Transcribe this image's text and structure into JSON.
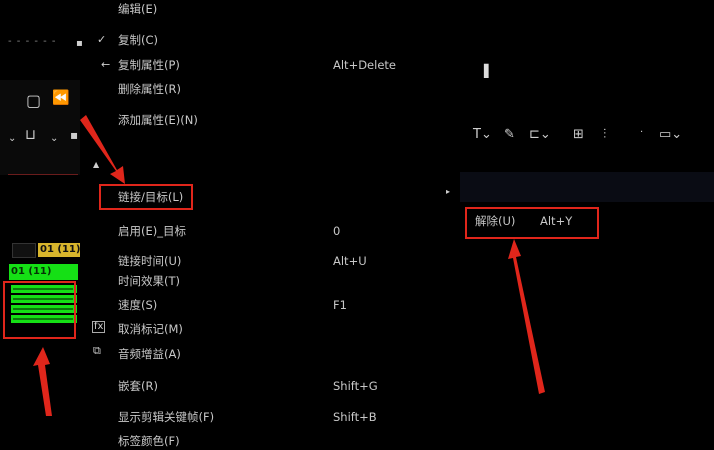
{
  "menu": {
    "items": [
      {
        "label": "编辑(E)",
        "shortcut": ""
      },
      {
        "label": "复制(C)",
        "shortcut": ""
      },
      {
        "label": "复制属性(P)",
        "shortcut": "Alt+Delete"
      },
      {
        "label": "删除属性(R)",
        "shortcut": ""
      },
      {
        "label": "添加属性(E)(N)",
        "shortcut": ""
      },
      {
        "label": "链接/目标(L)",
        "shortcut": ""
      },
      {
        "label": "启用(E)_目标",
        "shortcut": "0"
      },
      {
        "label": "链接时间(U)",
        "shortcut": "Alt+U"
      },
      {
        "label": "时间效果(T)",
        "shortcut": ""
      },
      {
        "label": "速度(S)",
        "shortcut": "F1"
      },
      {
        "label": "取消标记(M)",
        "shortcut": ""
      },
      {
        "label": "音频增益(A)",
        "shortcut": ""
      },
      {
        "label": "嵌套(R)",
        "shortcut": "Shift+G"
      },
      {
        "label": "显示剪辑关键帧(F)",
        "shortcut": "Shift+B"
      },
      {
        "label": "标签颜色(F)",
        "shortcut": ""
      }
    ]
  },
  "submenu": {
    "item_label": "解除(U)",
    "item_shortcut": "Alt+Y",
    "arrow": "▸"
  },
  "timeline": {
    "clip_label_yellow": "01 (11)",
    "clip_label_green": "01 (11)",
    "handle": "▌",
    "left_dots": "- - - - - -"
  },
  "colors": {
    "highlight_box": "#e0261b",
    "clip_green": "#15e015",
    "clip_yellow": "#d8b52c"
  }
}
